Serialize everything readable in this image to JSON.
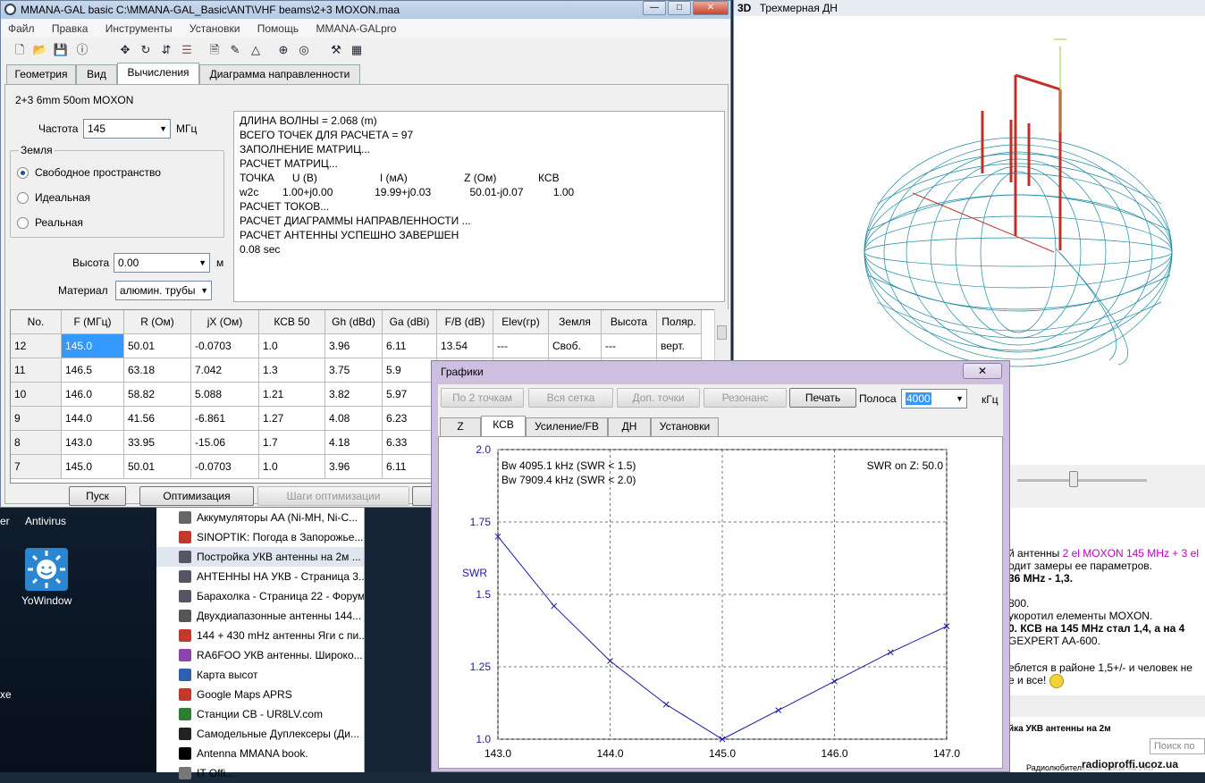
{
  "desktop": {
    "labels": [
      "er",
      "Antivirus",
      "YoWindow",
      "xe"
    ]
  },
  "bookmarks": [
    {
      "label": "Аккумуляторы AA (Ni-MH, Ni-C...",
      "color": "#666"
    },
    {
      "label": "SINOPTIK: Погода в Запорожье...",
      "color": "#c0392b"
    },
    {
      "label": "Постройка УКВ антенны на 2м ...",
      "color": "#556"
    },
    {
      "label": "АНТЕННЫ НА УКВ - Страница 3...",
      "color": "#556"
    },
    {
      "label": "Барахолка - Страница 22 - Форум",
      "color": "#556"
    },
    {
      "label": "Двухдиапазонные антенны 144...",
      "color": "#555"
    },
    {
      "label": "144 + 430 mHz антенны Яги с пи...",
      "color": "#c0392b"
    },
    {
      "label": "RA6FOO УКВ антенны. Широко...",
      "color": "#8e44ad"
    },
    {
      "label": "Карта высот",
      "color": "#2e5fb0"
    },
    {
      "label": "Google Maps APRS",
      "color": "#c0392b"
    },
    {
      "label": "Станции СВ - UR8LV.com",
      "color": "#2e7d32"
    },
    {
      "label": "Самодельные Дуплексеры (Ди...",
      "color": "#222"
    },
    {
      "label": "Antenna MMANA book.",
      "color": "#000"
    },
    {
      "label": "IT Offi...",
      "color": "#777"
    }
  ],
  "mmana": {
    "title": "MMANA-GAL basic C:\\MMANA-GAL_Basic\\ANT\\VHF beams\\2+3 MOXON.maa",
    "menu": [
      "Файл",
      "Правка",
      "Инструменты",
      "Установки",
      "Помощь",
      "MMANA-GALpro"
    ],
    "tabs": [
      "Геометрия",
      "Вид",
      "Вычисления",
      "Диаграмма направленности"
    ],
    "antenna_name": "2+3 6mm  50om  MOXON",
    "freq_label": "Частота",
    "freq_value": "145",
    "freq_unit": "МГц",
    "ground_group": "Земля",
    "ground_options": [
      "Свободное пространство",
      "Идеальная",
      "Реальная"
    ],
    "height_label": "Высота",
    "height_value": "0.00",
    "height_unit": "м",
    "material_label": "Материал",
    "material_value": "алюмин. трубы",
    "log": [
      "ДЛИНА ВОЛНЫ = 2.068 (m)",
      "ВСЕГО ТОЧЕК ДЛЯ РАСЧЕТА = 97",
      "ЗАПОЛНЕНИЕ МАТРИЦ...",
      "РАСЧЕТ МАТРИЦ...",
      "ТОЧКА      U (В)                     I (мА)                   Z (Ом)              КСВ",
      "w2c        1.00+j0.00              19.99+j0.03             50.01-j0.07          1.00",
      "РАСЧЕТ ТОКОВ...",
      "РАСЧЕТ ДИАГРАММЫ НАПРАВЛЕННОСТИ ...",
      "РАСЧЕТ АНТЕННЫ УСПЕШНО ЗАВЕРШЕН",
      "0.08 sec"
    ],
    "table": {
      "headers": [
        "No.",
        "F (МГц)",
        "R (Ом)",
        "jX (Ом)",
        "КСВ 50",
        "Gh (dBd)",
        "Ga (dBi)",
        "F/B (dB)",
        "Elev(гр)",
        "Земля",
        "Высота",
        "Поляр."
      ],
      "rows": [
        [
          "12",
          "145.0",
          "50.01",
          "-0.0703",
          "1.0",
          "3.96",
          "6.11",
          "13.54",
          "---",
          "Своб.",
          "---",
          "верт."
        ],
        [
          "11",
          "146.5",
          "63.18",
          "7.042",
          "1.3",
          "3.75",
          "5.9",
          "",
          "",
          "",
          "",
          ""
        ],
        [
          "10",
          "146.0",
          "58.82",
          "5.088",
          "1.21",
          "3.82",
          "5.97",
          "",
          "",
          "",
          "",
          ""
        ],
        [
          "9",
          "144.0",
          "41.56",
          "-6.861",
          "1.27",
          "4.08",
          "6.23",
          "",
          "",
          "",
          "",
          ""
        ],
        [
          "8",
          "143.0",
          "33.95",
          "-15.06",
          "1.7",
          "4.18",
          "6.33",
          "",
          "",
          "",
          "",
          ""
        ],
        [
          "7",
          "145.0",
          "50.01",
          "-0.0703",
          "1.0",
          "3.96",
          "6.11",
          "",
          "",
          "",
          "",
          ""
        ]
      ]
    },
    "buttons": {
      "start": "Пуск",
      "optimize": "Оптимизация",
      "opt_steps": "Шаги оптимизации"
    }
  },
  "win3d": {
    "badge": "3D",
    "title": "Трехмерная ДН"
  },
  "webpage": {
    "lines": [
      {
        "text": "й антенны ",
        "extra": "2 el MOXON 145 MHz + 3 el",
        "bold": false
      },
      {
        "text": "одит замеры ее параметров.",
        "extra": "",
        "bold": false
      },
      {
        "text": "36 MHz - 1,3.",
        "extra": "",
        "bold": true
      },
      {
        "text": "800.",
        "extra": "",
        "bold": false
      },
      {
        "text": " укоротил елементы MOXON.",
        "extra": "",
        "bold": false
      },
      {
        "text": "0. КСВ на 145 MHz стал 1,4, а на 4",
        "extra": "",
        "bold": true
      },
      {
        "text": "GEXPERT AA-600.",
        "extra": "",
        "bold": false
      },
      {
        "text": "еблется в районе 1,5+/- и человек не",
        "extra": "",
        "bold": false
      },
      {
        "text": "е и все! ",
        "extra": "",
        "bold": false
      },
      {
        "text": "йка УКВ антенны на 2м",
        "extra": "",
        "bold": true
      }
    ],
    "search_placeholder": "Поиск по",
    "footer": "Радиолюбительская связь на УКВ",
    "watermark": "radioproffi.ucoz.ua"
  },
  "graph": {
    "title": "Графики",
    "buttons": [
      "По 2 точкам",
      "Вся сетка",
      "Доп. точки",
      "Резонанс",
      "Печать"
    ],
    "band_label": "Полоса",
    "band_value": "4000",
    "band_unit": "кГц",
    "tabs": [
      "Z",
      "КСВ",
      "Усиление/FB",
      "ДН",
      "Установки"
    ],
    "bw1": "Bw 4095.1 kHz (SWR < 1.5)",
    "bw2": "Bw 7909.4 kHz (SWR < 2.0)",
    "swr_on": "SWR on Z: 50.0",
    "ylabel": "SWR"
  },
  "chart_data": {
    "type": "line",
    "title": "",
    "xlabel": "",
    "ylabel": "SWR",
    "x": [
      143.0,
      143.5,
      144.0,
      144.5,
      145.0,
      145.5,
      146.0,
      146.5,
      147.0
    ],
    "series": [
      {
        "values": [
          1.7,
          1.46,
          1.27,
          1.12,
          1.0,
          1.1,
          1.2,
          1.3,
          1.39
        ]
      }
    ],
    "xticks": [
      "143.0",
      "144.0",
      "145.0",
      "146.0",
      "147.0"
    ],
    "yticks": [
      "1.0",
      "1.25",
      "1.5",
      "1.75",
      "2.0"
    ],
    "xlim": [
      143.0,
      147.0
    ],
    "ylim": [
      1.0,
      2.0
    ],
    "grid": true,
    "line_color": "#1a1aa8"
  }
}
